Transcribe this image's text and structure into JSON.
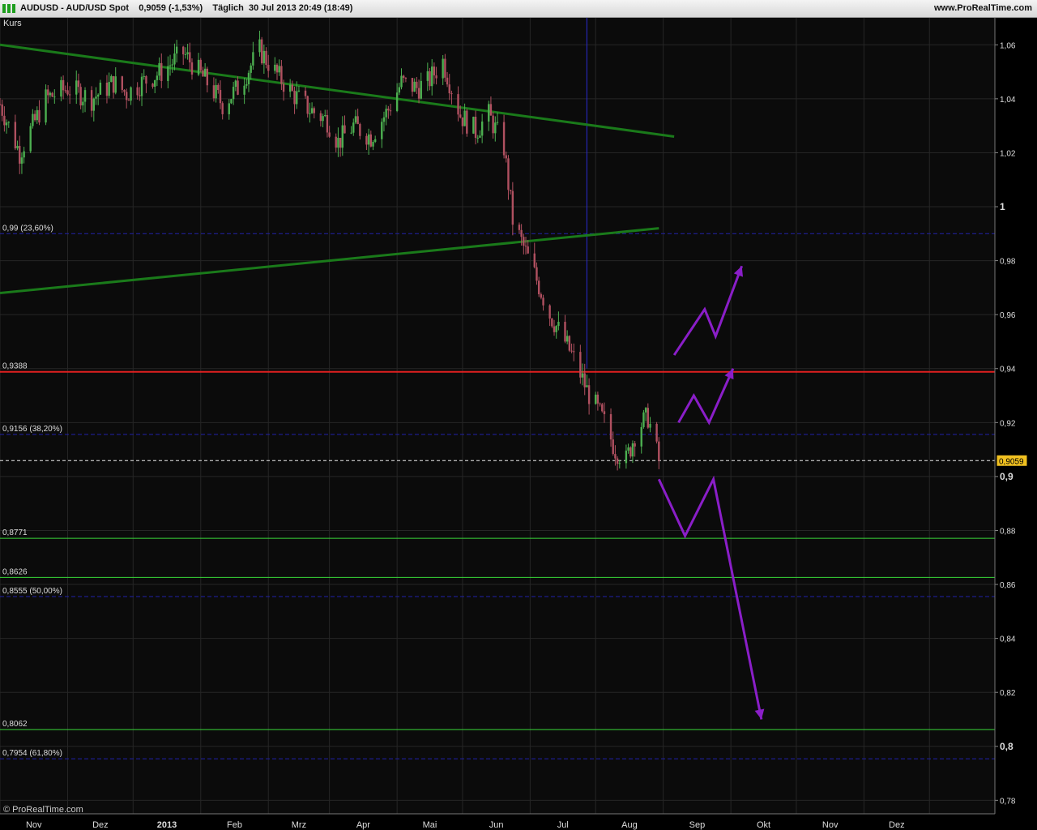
{
  "header": {
    "title": "AUDUSD - AUD/USD Spot    0,9059 (-1,53%)    Täglich  30 Jul 2013 20:49 (18:49)",
    "brand": "www.ProRealTime.com"
  },
  "footer": {
    "watermark": "© ProRealTime.com"
  },
  "colors": {
    "background": "#0b0b0b",
    "grid": "#262626",
    "candle_up": "#4caf50",
    "candle_down": "#b05060",
    "trendline": "#1a7a1a",
    "resistance": "#e02020",
    "support": "#39d839",
    "fib": "#2222aa",
    "arrow": "#8a1ec8",
    "current_price_badge": "#f0c020"
  },
  "chart_data": {
    "type": "candlestick",
    "title": "",
    "panel_label": "Kurs",
    "x_tick_labels": [
      "Nov",
      "Dez",
      "2013",
      "Feb",
      "Mrz",
      "Apr",
      "Mai",
      "Jun",
      "Jul",
      "Aug",
      "Sep",
      "Okt",
      "Nov",
      "Dez"
    ],
    "y_tick_labels": [
      "1,06",
      "1,04",
      "1,02",
      "1",
      "0,98",
      "0,96",
      "0,94",
      "0,92",
      "0,9",
      "0,88",
      "0,86",
      "0,84",
      "0,82",
      "0,8",
      "0,78"
    ],
    "y_ticks": [
      1.06,
      1.04,
      1.02,
      1.0,
      0.98,
      0.96,
      0.94,
      0.92,
      0.9,
      0.88,
      0.86,
      0.84,
      0.82,
      0.8,
      0.78
    ],
    "ylim": [
      0.775,
      1.07
    ],
    "date_range": [
      "2012-10-01",
      "2013-12-31"
    ],
    "current_price": {
      "value": 0.9059,
      "label": "0,9059"
    },
    "levels": [
      {
        "value": 0.9388,
        "label": "0,9388",
        "kind": "resistance"
      },
      {
        "value": 0.8771,
        "label": "0,8771",
        "kind": "support"
      },
      {
        "value": 0.8626,
        "label": "0,8626",
        "kind": "support"
      },
      {
        "value": 0.8062,
        "label": "0,8062",
        "kind": "support"
      },
      {
        "value": 0.99,
        "label": "0,99 (23,60%)",
        "kind": "fib"
      },
      {
        "value": 0.9156,
        "label": "0,9156 (38,20%)",
        "kind": "fib"
      },
      {
        "value": 0.8555,
        "label": "0,8555 (50,00%)",
        "kind": "fib"
      },
      {
        "value": 0.7954,
        "label": "0,7954 (61,80%)",
        "kind": "fib"
      }
    ],
    "vertical_marker": {
      "date": "2013-06-27",
      "value_top": 1.07,
      "value_bottom": 0.94
    },
    "trendlines": [
      {
        "from": [
          "2012-10-01",
          1.06
        ],
        "to": [
          "2013-08-06",
          1.026
        ]
      },
      {
        "from": [
          "2012-10-01",
          0.968
        ],
        "to": [
          "2013-07-30",
          0.992
        ]
      }
    ],
    "arrows": [
      {
        "points": [
          [
            "2013-08-06",
            0.945
          ],
          [
            "2013-08-20",
            0.962
          ],
          [
            "2013-08-25",
            0.952
          ],
          [
            "2013-09-06",
            0.978
          ]
        ]
      },
      {
        "points": [
          [
            "2013-08-08",
            0.92
          ],
          [
            "2013-08-15",
            0.93
          ],
          [
            "2013-08-22",
            0.92
          ],
          [
            "2013-09-02",
            0.94
          ]
        ]
      },
      {
        "points": [
          [
            "2013-07-30",
            0.899
          ],
          [
            "2013-08-11",
            0.878
          ],
          [
            "2013-08-24",
            0.899
          ],
          [
            "2013-09-15",
            0.81
          ]
        ]
      }
    ],
    "price_path": [
      [
        "2012-10-01",
        1.038
      ],
      [
        "2012-10-10",
        1.02
      ],
      [
        "2012-10-16",
        1.03
      ],
      [
        "2012-10-22",
        1.04
      ],
      [
        "2012-11-01",
        1.044
      ],
      [
        "2012-11-12",
        1.04
      ],
      [
        "2012-11-22",
        1.046
      ],
      [
        "2012-11-28",
        1.042
      ],
      [
        "2012-12-05",
        1.046
      ],
      [
        "2012-12-14",
        1.05
      ],
      [
        "2012-12-24",
        1.057
      ],
      [
        "2013-01-04",
        1.046
      ],
      [
        "2013-01-11",
        1.038
      ],
      [
        "2013-01-18",
        1.044
      ],
      [
        "2013-01-28",
        1.058
      ],
      [
        "2013-02-04",
        1.05
      ],
      [
        "2013-02-12",
        1.042
      ],
      [
        "2013-02-20",
        1.036
      ],
      [
        "2013-02-28",
        1.032
      ],
      [
        "2013-03-05",
        1.024
      ],
      [
        "2013-03-12",
        1.03
      ],
      [
        "2013-03-20",
        1.026
      ],
      [
        "2013-03-28",
        1.036
      ],
      [
        "2013-04-03",
        1.046
      ],
      [
        "2013-04-10",
        1.044
      ],
      [
        "2013-04-15",
        1.046
      ],
      [
        "2013-04-22",
        1.054
      ],
      [
        "2013-04-30",
        1.034
      ],
      [
        "2013-05-07",
        1.028
      ],
      [
        "2013-05-13",
        1.034
      ],
      [
        "2013-05-20",
        1.022
      ],
      [
        "2013-05-24",
        0.995
      ],
      [
        "2013-06-03",
        0.975
      ],
      [
        "2013-06-10",
        0.96
      ],
      [
        "2013-06-17",
        0.95
      ],
      [
        "2013-06-22",
        0.942
      ],
      [
        "2013-06-27",
        0.932
      ],
      [
        "2013-07-05",
        0.92
      ],
      [
        "2013-07-10",
        0.91
      ],
      [
        "2013-07-15",
        0.906
      ],
      [
        "2013-07-20",
        0.918
      ],
      [
        "2013-07-25",
        0.922
      ],
      [
        "2013-07-30",
        0.906
      ]
    ]
  }
}
